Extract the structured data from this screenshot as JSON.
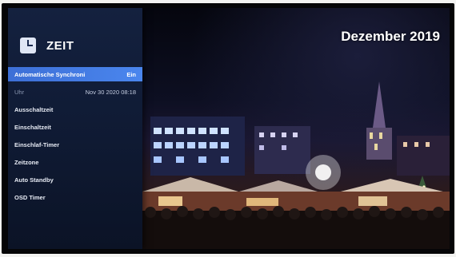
{
  "osd": {
    "title": "ZEIT",
    "icon": "clock-icon",
    "items": [
      {
        "label": "Automatische Synchroni",
        "value": "Ein",
        "selected": true
      },
      {
        "label": "Uhr",
        "value": "Nov 30 2020  08:18",
        "selected": false,
        "dim": true
      },
      {
        "label": "Ausschaltzeit",
        "value": ""
      },
      {
        "label": "Einschaltzeit",
        "value": ""
      },
      {
        "label": "Einschlaf-Timer",
        "value": ""
      },
      {
        "label": "Zeitzone",
        "value": ""
      },
      {
        "label": "Auto Standby",
        "value": ""
      },
      {
        "label": "OSD Timer",
        "value": ""
      }
    ]
  },
  "background": {
    "caption": "Dezember 2019"
  },
  "colors": {
    "panel": "#14213f",
    "selection": "#4a86ee",
    "text": "#ffffff"
  }
}
